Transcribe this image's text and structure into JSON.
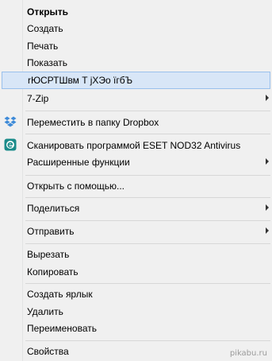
{
  "menu": {
    "items": [
      {
        "label": "Открыть"
      },
      {
        "label": "Создать"
      },
      {
        "label": "Печать"
      },
      {
        "label": "Показать"
      },
      {
        "label": "rЮСРТШвм T jXЭo ïгбЪ"
      },
      {
        "label": "7-Zip"
      },
      {
        "label": "Переместить в папку Dropbox"
      },
      {
        "label": "Сканировать программой ESET NOD32 Antivirus"
      },
      {
        "label": "Расширенные функции"
      },
      {
        "label": "Открыть с помощью..."
      },
      {
        "label": "Поделиться"
      },
      {
        "label": "Отправить"
      },
      {
        "label": "Вырезать"
      },
      {
        "label": "Копировать"
      },
      {
        "label": "Создать ярлык"
      },
      {
        "label": "Удалить"
      },
      {
        "label": "Переименовать"
      },
      {
        "label": "Свойства"
      }
    ]
  },
  "icons": {
    "dropbox": "dropbox-icon",
    "eset": "eset-icon"
  },
  "colors": {
    "menu_bg": "#f0f0f0",
    "highlight_bg": "#d8e6f7",
    "highlight_border": "#99c0ec",
    "eset_green": "#1a8b8a",
    "dropbox_blue": "#3d8ad8"
  },
  "watermark": "pikabu.ru"
}
